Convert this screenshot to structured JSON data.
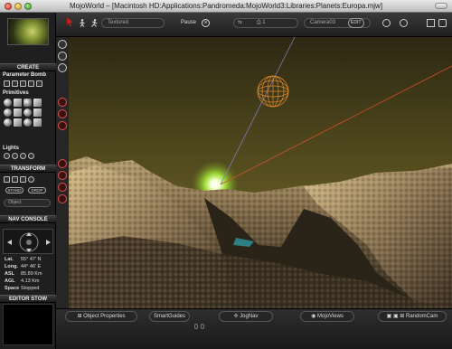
{
  "window": {
    "title": "MojoWorld – [Macintosh HD:Applications:Pandromeda:MojoWorld3:Libraries:Planets:Europa.mjw]"
  },
  "left_panel": {
    "create_header": "CREATE",
    "parameter_bomb_label": "Parameter Bomb",
    "primitives_label": "Primitives",
    "lights_label": "Lights",
    "transform_header": "TRANSFORM",
    "stand_label": "STAND",
    "drop_label": "DROP",
    "nav_console_header": "NAV CONSOLE",
    "nav": {
      "lat_label": "Lat.",
      "lat_value": "55° 47' N",
      "long_label": "Long.",
      "long_value": "44° 46' E",
      "asl_label": "ASL",
      "asl_value": "85.89 Km",
      "agl_label": "AGL",
      "agl_value": "4.13 Km",
      "space_label": "Space",
      "space_value": "Stopped"
    },
    "editor_stow_header": "EDITOR STOW",
    "object_field_placeholder": "Object"
  },
  "toolbar": {
    "render_mode": "Textured",
    "pause_label": "Pause",
    "camera_label": "Camera03",
    "edit_label": "EDIT",
    "frame_label": "1"
  },
  "bottom_bar": {
    "object_properties": "Object Properties",
    "smart_guides": "SmartGuides",
    "jog_nav": "JogNav",
    "mojo_views": "MojoViews",
    "random_cam": "RandomCam"
  },
  "colors": {
    "sky_top": "#2e2813",
    "sky_horizon": "#6b6224",
    "sun_glow": "#a6e83a",
    "accent_red": "#c02020",
    "wireframe_sphere": "#e08c32"
  }
}
